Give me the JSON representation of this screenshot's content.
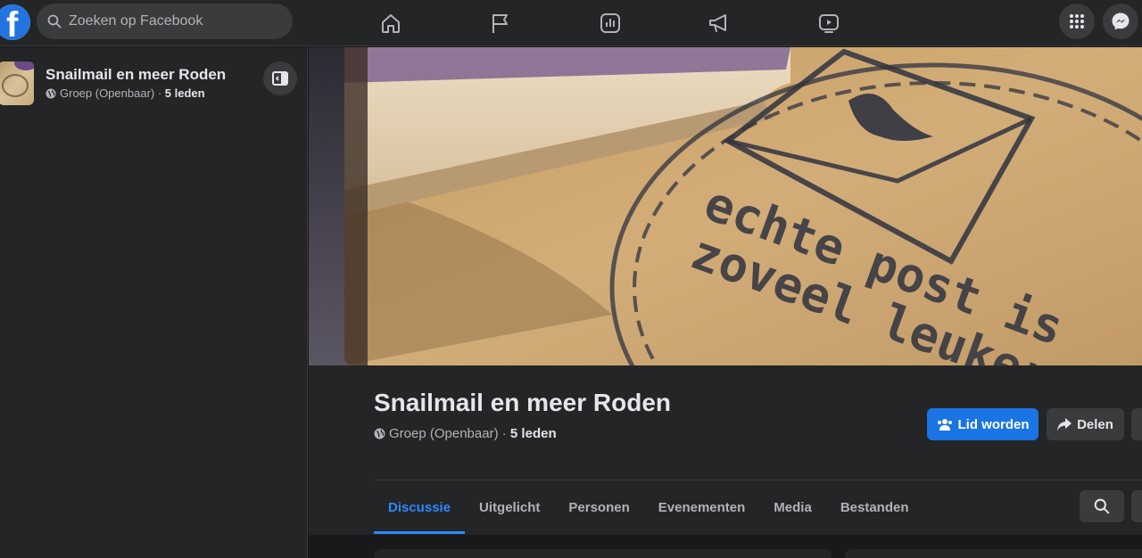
{
  "app": {
    "logo_letter": "f",
    "colors": {
      "accent": "#2d88ff",
      "primary_button": "#1b74e4",
      "background": "#18191a",
      "surface": "#242526"
    }
  },
  "search": {
    "placeholder": "Zoeken op Facebook"
  },
  "nav": {
    "icons": [
      "home-icon",
      "flag-icon",
      "chart-icon",
      "megaphone-icon",
      "video-icon"
    ],
    "right_icons": [
      "menu-grid-icon",
      "messenger-icon"
    ]
  },
  "sidebar": {
    "group_title": "Snailmail en meer Roden",
    "group_type": "Groep (Openbaar)",
    "separator": " · ",
    "members": "5 leden"
  },
  "group": {
    "name": "Snailmail en meer Roden",
    "type": "Groep (Openbaar)",
    "separator": " · ",
    "members": "5 leden",
    "cover_text_line1": "echte post is",
    "cover_text_line2": "zoveel leuker",
    "join_label": "Lid worden",
    "share_label": "Delen"
  },
  "tabs": [
    {
      "label": "Discussie",
      "active": true
    },
    {
      "label": "Uitgelicht",
      "active": false
    },
    {
      "label": "Personen",
      "active": false
    },
    {
      "label": "Evenementen",
      "active": false
    },
    {
      "label": "Media",
      "active": false
    },
    {
      "label": "Bestanden",
      "active": false
    }
  ]
}
